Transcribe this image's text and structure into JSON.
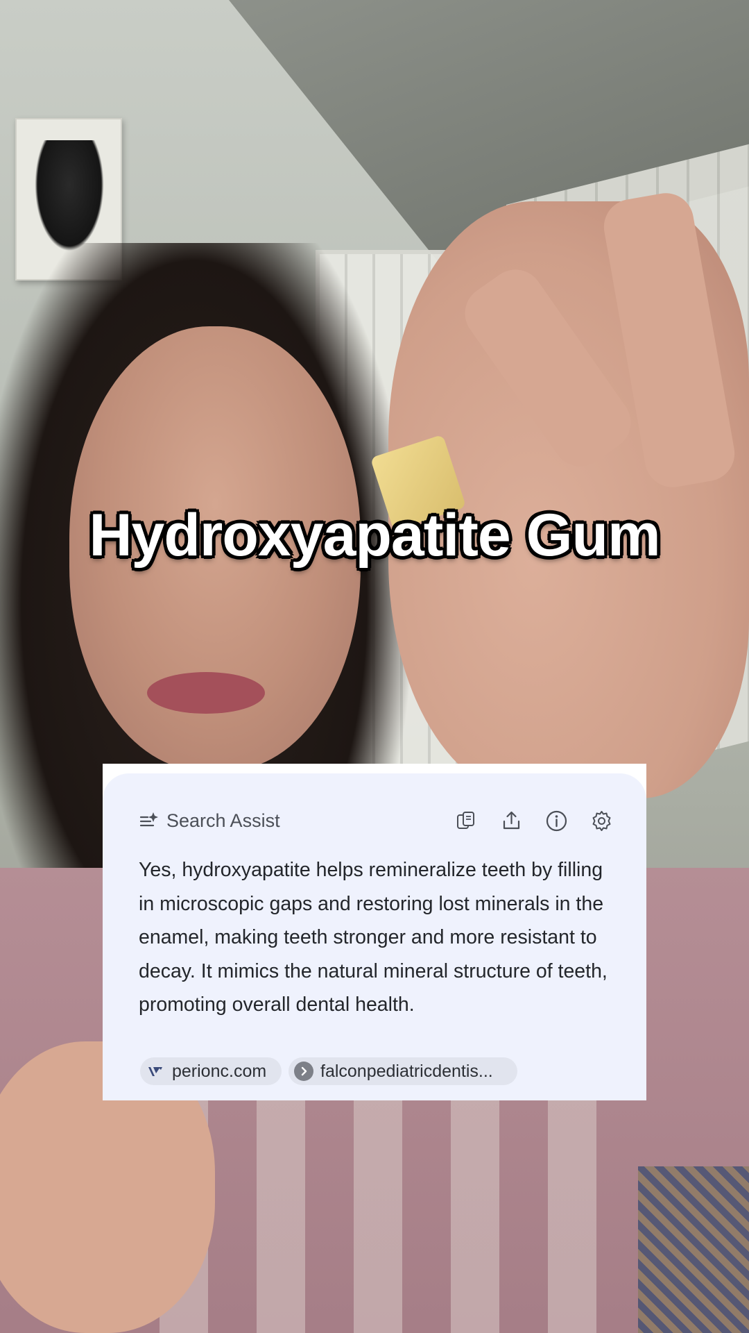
{
  "overlay": {
    "caption": "Hydroxyapatite Gum"
  },
  "search_assist": {
    "title": "Search Assist",
    "icons": [
      "sparkle-list-icon",
      "copy-icon",
      "share-icon",
      "info-icon",
      "settings-gear-icon"
    ],
    "answer": "Yes, hydroxyapatite helps remineralize teeth by filling in microscopic gaps and restoring lost minerals in the enamel, making teeth stronger and more resistant to decay. It mimics the natural mineral structure of teeth, promoting overall dental health.",
    "sources": [
      {
        "label": "perionc.com",
        "icon": "perionc-favicon"
      },
      {
        "label": "falconpediatricdentis...",
        "icon": "chevron-right-favicon"
      }
    ]
  },
  "colors": {
    "card_bg": "#eff2fd",
    "chip_bg": "#e1e4ee",
    "text": "#23262b",
    "muted": "#4b4f57"
  }
}
